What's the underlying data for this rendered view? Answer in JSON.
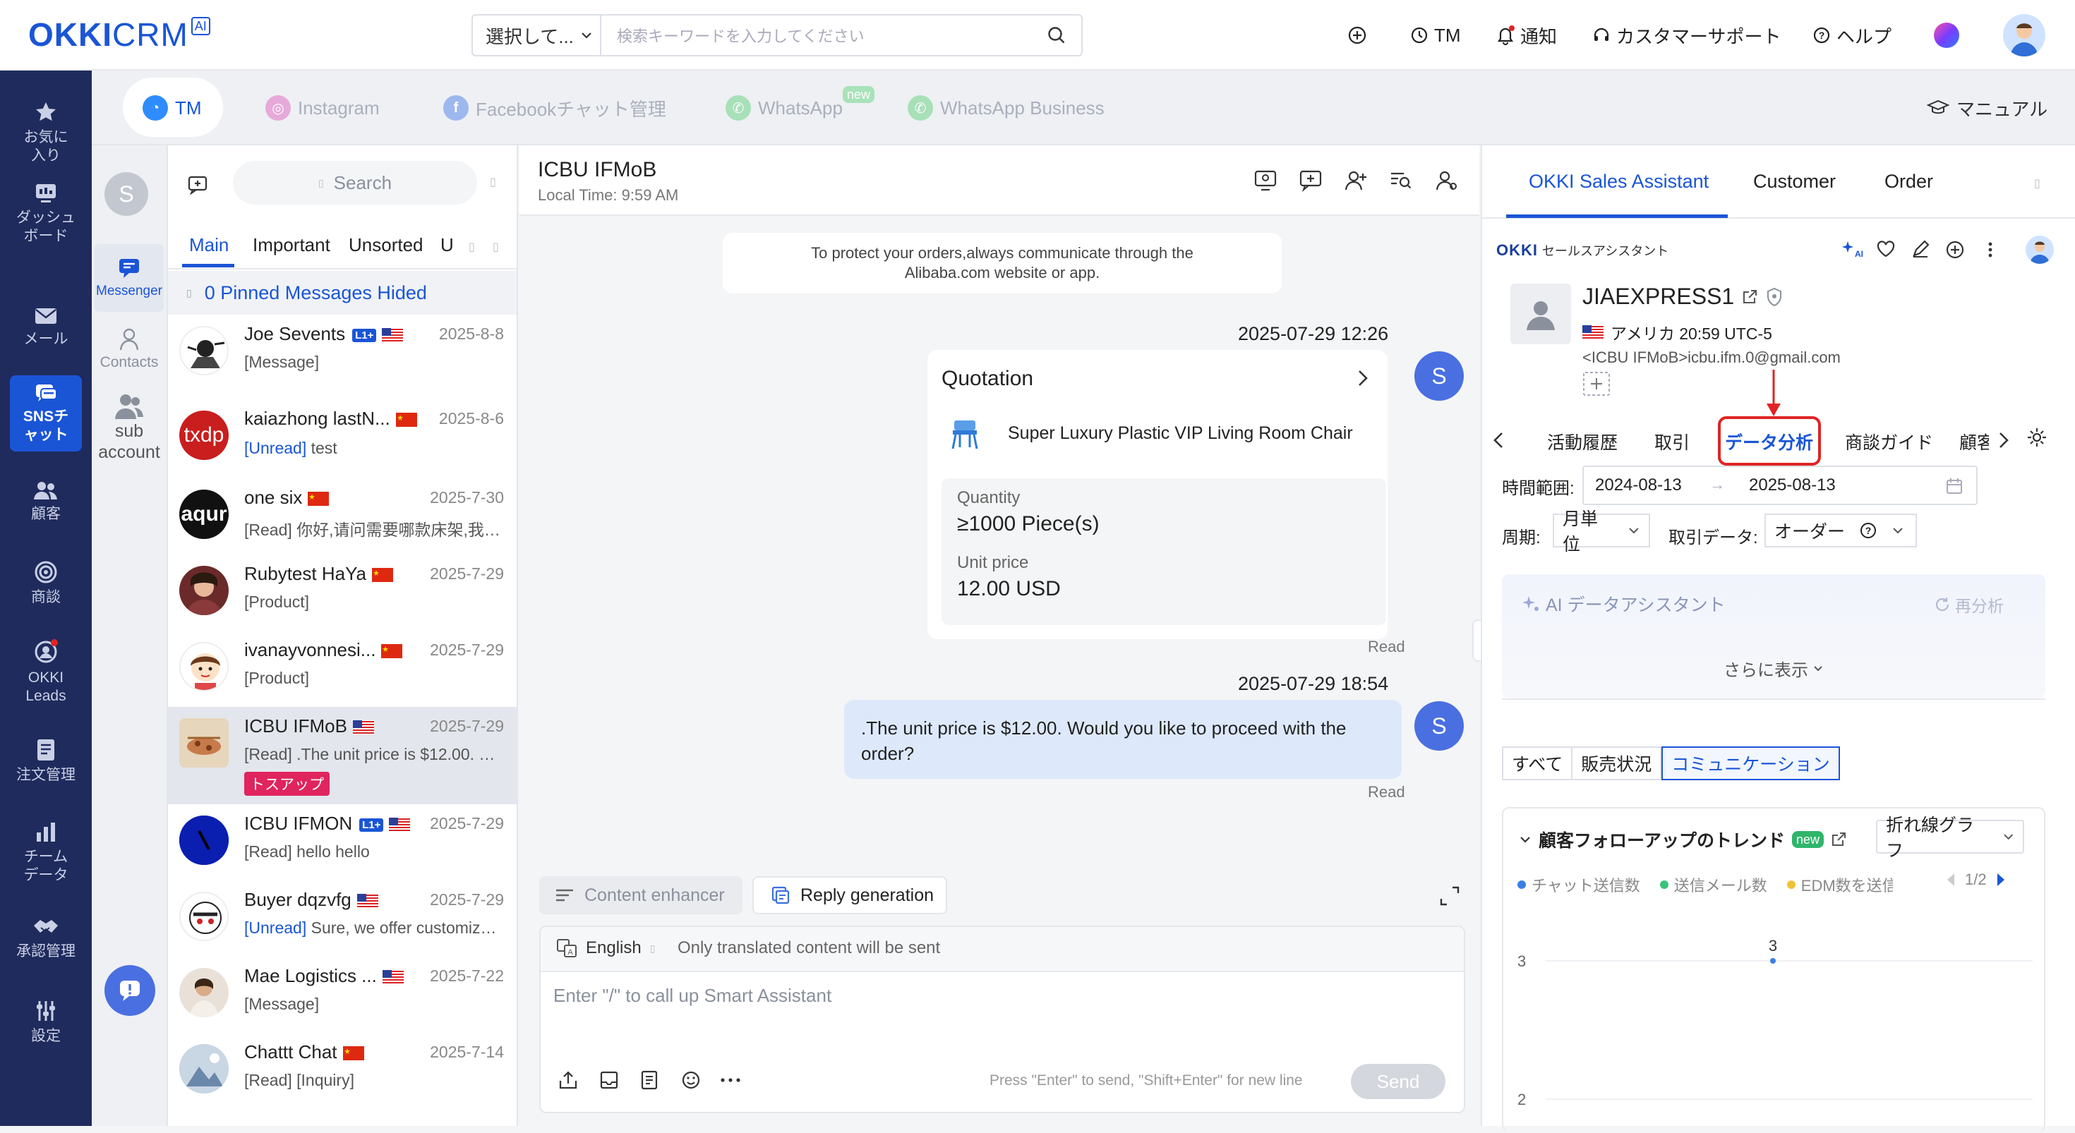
{
  "app": {
    "logo_main": "OKKI",
    "logo_sub": "CRM",
    "logo_badge": "AI"
  },
  "search": {
    "selector": "選択して...",
    "placeholder": "検索キーワードを入力してください"
  },
  "topbar": {
    "tm": "TM",
    "notify": "通知",
    "support": "カスタマーサポート",
    "help": "ヘルプ"
  },
  "leftnav": [
    {
      "label": "お気に入り"
    },
    {
      "label": "ダッシュボード"
    },
    {
      "label": "メール"
    },
    {
      "label": "SNSチャット"
    },
    {
      "label": "顧客"
    },
    {
      "label": "商談"
    },
    {
      "label": "OKKI Leads"
    },
    {
      "label": "注文管理"
    },
    {
      "label": "チームデータ"
    },
    {
      "label": "承認管理"
    },
    {
      "label": "設定"
    }
  ],
  "col2": {
    "avatar": "S",
    "messenger": "Messenger",
    "contacts": "Contacts",
    "sub_account": "sub account"
  },
  "channels": {
    "tm": "TM",
    "instagram": "Instagram",
    "facebook": "Facebookチャット管理",
    "whatsapp": "WhatsApp",
    "whatsapp_new": "new",
    "whatsapp_business": "WhatsApp Business",
    "manual": "マニュアル"
  },
  "convlist": {
    "search_placeholder": "Search",
    "tabs": [
      "Main",
      "Important",
      "Unsorted",
      "U"
    ],
    "pinned": "0 Pinned Messages Hided",
    "items": [
      {
        "name": "Joe Sevents",
        "badge": "L1+",
        "date": "2025-8-8",
        "preview": "[Message]"
      },
      {
        "name": "kaiazhong lastN...",
        "date": "2025-8-6",
        "preview_tag": "[Unread]",
        "preview": "test",
        "avatar_text": "txdp"
      },
      {
        "name": "one six",
        "date": "2025-7-30",
        "preview": "[Read]  你好,请问需要哪款床架,我…",
        "avatar_text": "aqur"
      },
      {
        "name": "Rubytest HaYa",
        "date": "2025-7-29",
        "preview": "[Product]"
      },
      {
        "name": "ivanayvonnesi...",
        "date": "2025-7-29",
        "preview": "[Product]"
      },
      {
        "name": "ICBU IFMoB",
        "date": "2025-7-29",
        "preview": "[Read]  .The unit price is $12.00. …",
        "tag": "トスアップ"
      },
      {
        "name": "ICBU IFMON",
        "badge": "L1+",
        "date": "2025-7-29",
        "preview": "[Read]  hello hello"
      },
      {
        "name": "Buyer dqzvfg",
        "date": "2025-7-29",
        "preview_tag": "[Unread]",
        "preview": "Sure, we offer customiz…"
      },
      {
        "name": "Mae Logistics ...",
        "date": "2025-7-22",
        "preview": "[Message]"
      },
      {
        "name": "Chattt Chat",
        "date": "2025-7-14",
        "preview": "[Read]  [Inquiry]"
      }
    ]
  },
  "chat": {
    "title": "ICBU IFMoB",
    "local_time": "Local Time: 9:59 AM",
    "notice": "To protect your orders,always communicate through the Alibaba.com website or app.",
    "ts1": "2025-07-29 12:26",
    "quotation": {
      "title": "Quotation",
      "product": "Super Luxury Plastic VIP Living Room Chair",
      "qty_label": "Quantity",
      "qty_value": "≥1000 Piece(s)",
      "price_label": "Unit price",
      "price_value": "12.00 USD"
    },
    "read1": "Read",
    "ts2": "2025-07-29 18:54",
    "message": ".The unit price is $12.00. Would you like to proceed with the order?",
    "read2": "Read",
    "sender_avatar": "S",
    "content_enhancer": "Content enhancer",
    "reply_generation": "Reply generation",
    "lang": "English",
    "lang_note": "Only translated content will be sent",
    "input_placeholder": "Enter \"/\" to call up Smart Assistant",
    "send_hint": "Press \"Enter\" to send, \"Shift+Enter\" for new line",
    "send": "Send"
  },
  "right": {
    "tabs": [
      "OKKI Sales Assistant",
      "Customer",
      "Order"
    ],
    "brand": "OKKI",
    "brand_sub": "セールスアシスタント",
    "customer_name": "JIAEXPRESS1",
    "location": "アメリカ 20:59 UTC-5",
    "email": "<ICBU IFMoB>icbu.ifm.0@gmail.com",
    "detail_tabs": [
      "活動履歴",
      "取引",
      "データ分析",
      "商談ガイド",
      "顧客"
    ],
    "time_range_label": "時間範囲:",
    "date_from": "2024-08-13",
    "date_to": "2025-08-13",
    "period_label": "周期:",
    "period_value": "月単位",
    "trade_label": "取引データ:",
    "trade_value": "オーダー",
    "ai_title": "AI データアシスタント",
    "reanalyze": "再分析",
    "show_more": "さらに表示",
    "segments": [
      "すべて",
      "販売状況",
      "コミュニケーション"
    ],
    "trend_title": "顧客フォローアップのトレンド",
    "trend_new": "new",
    "chart_type": "折れ線グラフ",
    "legend_page": "1/2",
    "colors": {
      "accent": "#1a55d6",
      "red": "#e02424",
      "nav": "#1f2b5c"
    }
  },
  "chart_data": {
    "type": "line",
    "title": "顧客フォローアップのトレンド",
    "series": [
      {
        "name": "チャット送信数",
        "values": [
          3
        ]
      },
      {
        "name": "送信メール数",
        "values": []
      },
      {
        "name": "EDM数を送信す",
        "values": []
      }
    ],
    "point_labels": [
      "3"
    ],
    "yticks": [
      "3",
      "2"
    ],
    "ylim": [
      2,
      3
    ],
    "legend": "top"
  }
}
